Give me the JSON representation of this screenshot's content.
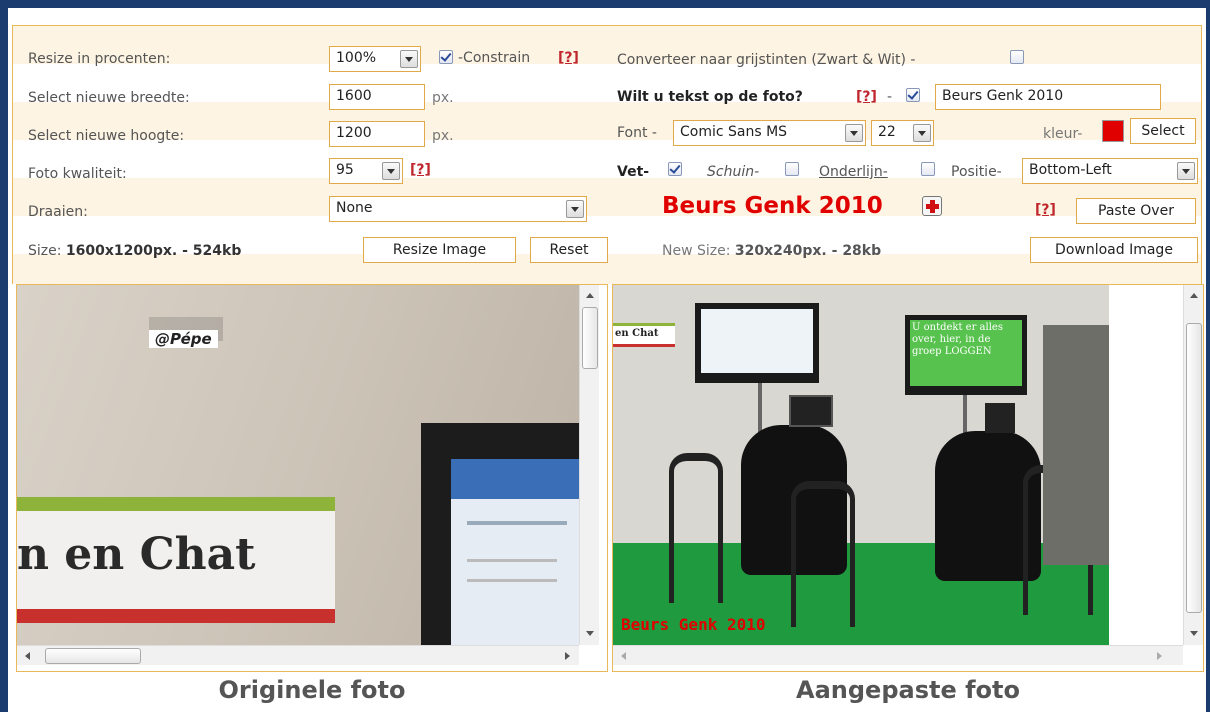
{
  "form": {
    "resize_label": "Resize in procenten:",
    "resize_value": "100%",
    "constrain_label": "-Constrain",
    "help": "[?]",
    "width_label": "Select nieuwe breedte:",
    "width_value": "1600",
    "height_label": "Select nieuwe hoogte:",
    "height_value": "1200",
    "px": "px.",
    "quality_label": "Foto kwaliteit:",
    "quality_value": "95",
    "rotate_label": "Draaien:",
    "rotate_value": "None",
    "size_prefix": "Size:",
    "size_value": "1600x1200px. - 524kb",
    "resize_button": "Resize Image",
    "reset_button": "Reset",
    "grayscale_label": "Converteer naar grijstinten (Zwart & Wit) -",
    "text_question": "Wilt u tekst op de foto?",
    "text_value": "Beurs Genk 2010",
    "font_label": "Font -",
    "font_value": "Comic Sans MS",
    "font_size": "22",
    "color_label": "kleur-",
    "color_value": "#e00000",
    "select_button": "Select",
    "bold_label": "Vet-",
    "italic_label": "Schuin-",
    "underline_label": "Onderlijn-",
    "position_label": "Positie-",
    "position_value": "Bottom-Left",
    "preview_text": "Beurs Genk 2010",
    "paste_button": "Paste Over",
    "new_size_prefix": "New Size:",
    "new_size_value": "320x240px. - 28kb",
    "download_button": "Download Image"
  },
  "original": {
    "watermark": "@Pépe",
    "sign_text": "n en Chat",
    "caption": "Originele foto"
  },
  "edited": {
    "sign_text": "en Chat",
    "overlay_text": "Beurs Genk 2010",
    "screen_text": "U ontdekt er alles over, hier, in de groep LOGGEN",
    "caption": "Aangepaste foto"
  },
  "colors": {
    "accent": "#e8b85b",
    "red": "#e00000",
    "frame": "#1b3c6e"
  }
}
